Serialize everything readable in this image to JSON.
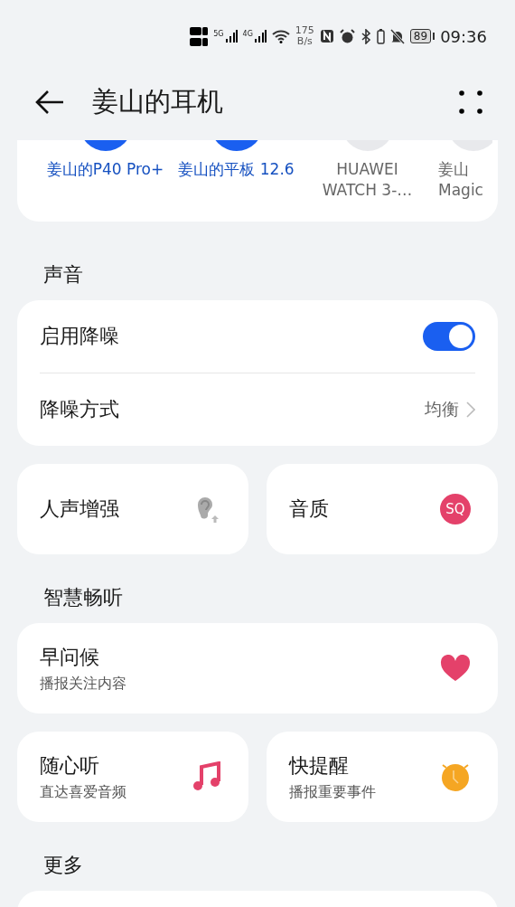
{
  "status_bar": {
    "network_1": "5G",
    "network_2": "4G",
    "speed": "175",
    "speed_unit": "B/s",
    "battery": "89",
    "time": "09:36"
  },
  "header": {
    "title": "姜山的耳机"
  },
  "devices": [
    {
      "name": "姜山的P40 Pro+",
      "connected": true
    },
    {
      "name": "姜山的平板 12.6",
      "connected": true
    },
    {
      "name": "HUAWEI WATCH 3-…",
      "connected": false
    },
    {
      "name": "姜山",
      "name_2": "Magic",
      "connected": false
    }
  ],
  "sections": [
    {
      "title": "声音",
      "rows": [
        {
          "kind": "toggle",
          "label": "启用降噪",
          "on": true
        },
        {
          "kind": "value",
          "label": "降噪方式",
          "value": "均衡"
        }
      ],
      "tiles": [
        {
          "label": "人声增强"
        },
        {
          "label": "音质",
          "badge": "SQ"
        }
      ]
    },
    {
      "title": "智慧畅听",
      "wide": {
        "label": "早问候",
        "sub": "播报关注内容"
      },
      "tiles": [
        {
          "label": "随心听",
          "sub": "直达喜爱音频"
        },
        {
          "label": "快提醒",
          "sub": "播报重要事件"
        }
      ]
    },
    {
      "title": "更多"
    }
  ]
}
